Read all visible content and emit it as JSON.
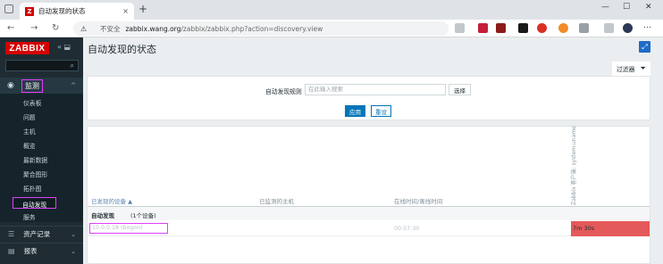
{
  "browser": {
    "tab_title": "自动发现的状态",
    "insecure_label": "不安全",
    "url_host": "zabbix.wang.org",
    "url_path": "/zabbix/zabbix.php?action=discovery.view",
    "new_tab": "+",
    "close_tab": "×"
  },
  "sidebar": {
    "logo": "ZABBIX",
    "tools": "«  ⬓",
    "main_menu_label": "监测",
    "submenu": [
      "仪表板",
      "问题",
      "主机",
      "概览",
      "最新数据",
      "聚合图形",
      "拓扑图",
      "自动发现",
      "服务"
    ],
    "sections": [
      {
        "label": "资产记录"
      },
      {
        "label": "报表"
      }
    ]
  },
  "main": {
    "title": "自动发现的状态",
    "filter_tab": "过滤器",
    "filter_label": "自动发现规则",
    "filter_placeholder": "在此输入搜索",
    "select_button": "选择",
    "apply_button": "应用",
    "reset_button": "重设"
  },
  "table": {
    "headers": {
      "devices": "已发现的设备 ▲",
      "monitored": "已监测的主机",
      "uptime": "在线时间/离线时间",
      "vertical": "Zabbix 客户端: system.uname"
    },
    "group_name": "自动发现",
    "group_count": "(1个设备)",
    "rows": [
      {
        "device": "10.0.0.18 (bogon)",
        "time": "00:57:30",
        "value": "7m 30s"
      }
    ]
  },
  "colors": {
    "brand": "#d40000",
    "sidebar": "#1f2c33",
    "accent": "#0275b8",
    "highlight": "#e040fb",
    "problem": "#e45959"
  }
}
